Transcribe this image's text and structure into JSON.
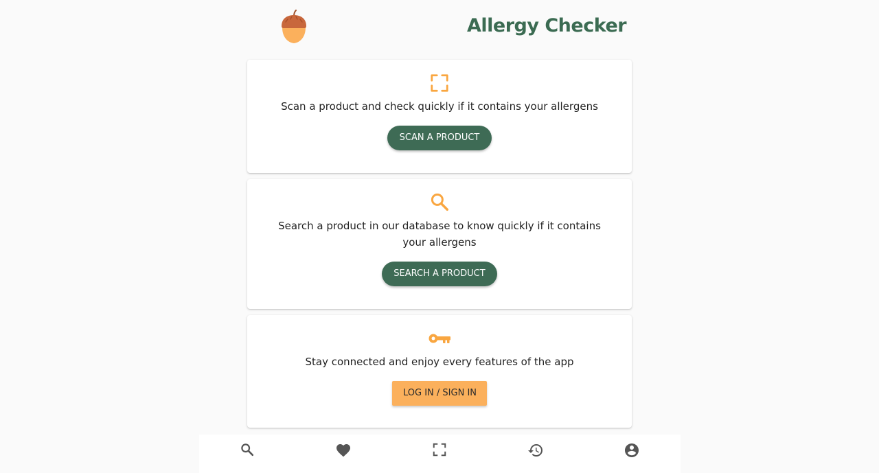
{
  "header": {
    "title": "Allergy Checker",
    "logo_icon": "acorn-icon"
  },
  "cards": [
    {
      "icon": "scan-frame-icon",
      "text": "Scan a product and check quickly if it contains your allergens",
      "button_label": "SCAN A PRODUCT"
    },
    {
      "icon": "search-icon",
      "text": "Search a product in our database to know quickly if it contains your allergens",
      "button_label": "SEARCH A PRODUCT"
    },
    {
      "icon": "key-icon",
      "text": "Stay connected and enjoy every features of the app",
      "button_label": "LOG IN / SIGN IN"
    }
  ],
  "bottom_nav": {
    "items": [
      {
        "icon": "search-icon"
      },
      {
        "icon": "heart-icon"
      },
      {
        "icon": "scan-frame-icon"
      },
      {
        "icon": "history-icon"
      },
      {
        "icon": "account-circle-icon"
      }
    ]
  },
  "colors": {
    "primary_green": "#3e6b55",
    "title_green": "#3b6b52",
    "accent_orange": "#fbb05c",
    "icon_orange": "#f9a640",
    "background": "#fafafa"
  }
}
